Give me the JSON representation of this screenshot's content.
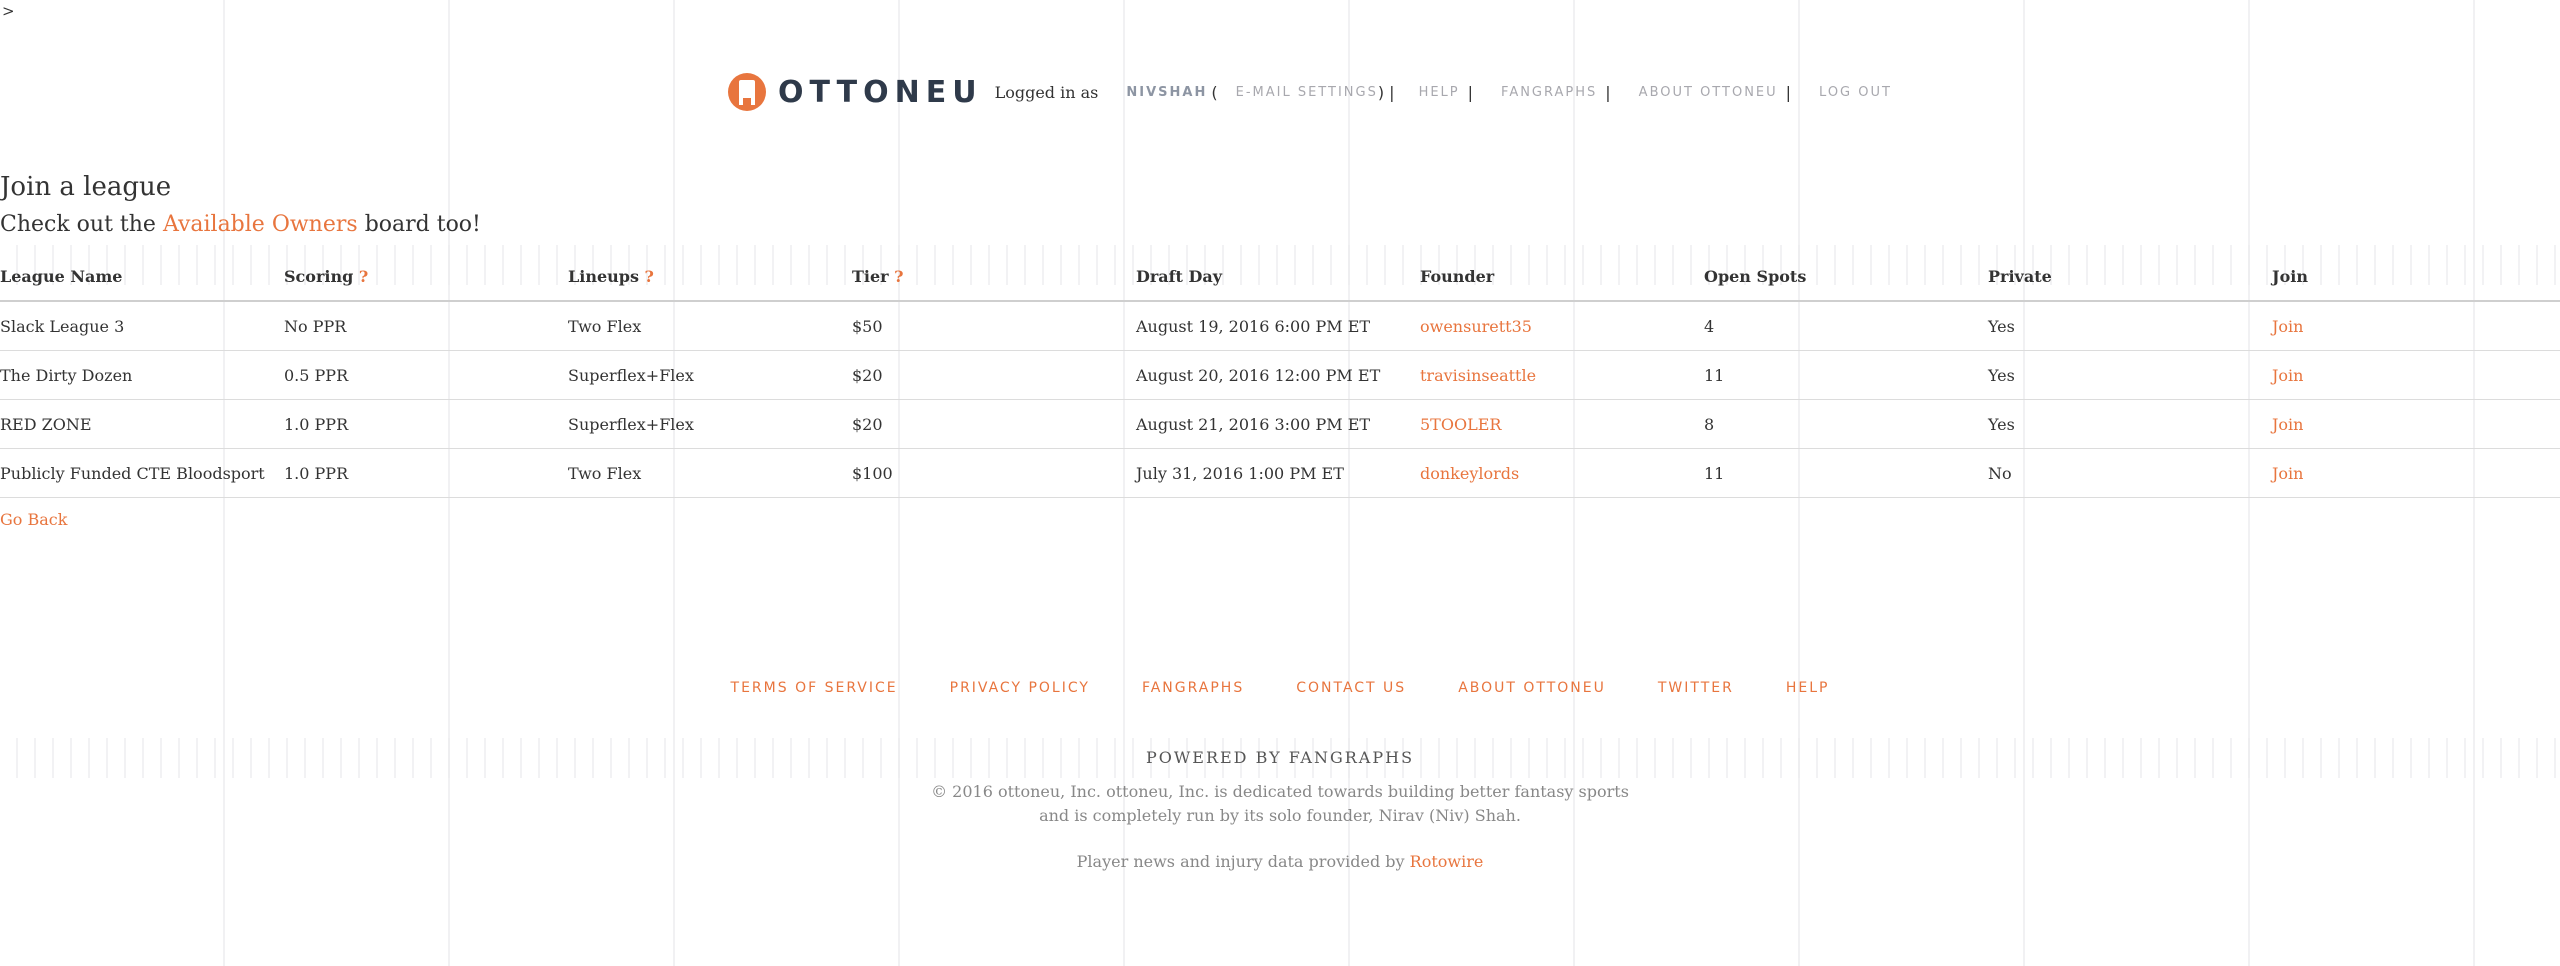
{
  "stray_char": ">",
  "header": {
    "logo_text": "OTTONEU",
    "logged_in_label": "Logged in as",
    "username": "NIVSHAH",
    "open_paren": "(",
    "email_settings": "E-MAIL SETTINGS",
    "close_paren_sep": ") |",
    "help": "HELP",
    "fangraphs": "FANGRAPHS",
    "about": "ABOUT OTTONEU",
    "logout": "LOG OUT",
    "sep": "|"
  },
  "main": {
    "title": "Join a league",
    "subtitle_before": "Check out the",
    "subtitle_link": "Available Owners",
    "subtitle_after": "board too!",
    "go_back": "Go Back"
  },
  "table": {
    "headers": {
      "league_name": "League Name",
      "scoring": "Scoring",
      "lineups": "Lineups",
      "tier": "Tier",
      "draft_day": "Draft Day",
      "founder": "Founder",
      "open_spots": "Open Spots",
      "private": "Private",
      "join": "Join",
      "help_mark": "?"
    },
    "rows": [
      {
        "league_name": "Slack League 3",
        "scoring": "No PPR",
        "lineups": "Two Flex",
        "tier": "$50",
        "draft_day": "August 19, 2016 6:00 PM ET",
        "founder": "owensurett35",
        "open_spots": "4",
        "private": "Yes",
        "join": "Join"
      },
      {
        "league_name": "The Dirty Dozen",
        "scoring": "0.5 PPR",
        "lineups": "Superflex+Flex",
        "tier": "$20",
        "draft_day": "August 20, 2016 12:00 PM ET",
        "founder": "travisinseattle",
        "open_spots": "11",
        "private": "Yes",
        "join": "Join"
      },
      {
        "league_name": "RED ZONE",
        "scoring": "1.0 PPR",
        "lineups": "Superflex+Flex",
        "tier": "$20",
        "draft_day": "August 21, 2016 3:00 PM ET",
        "founder": "5TOOLER",
        "open_spots": "8",
        "private": "Yes",
        "join": "Join"
      },
      {
        "league_name": "Publicly Funded CTE Bloodsport",
        "scoring": "1.0 PPR",
        "lineups": "Two Flex",
        "tier": "$100",
        "draft_day": "July 31, 2016 1:00 PM ET",
        "founder": "donkeylords",
        "open_spots": "11",
        "private": "No",
        "join": "Join"
      }
    ]
  },
  "footer": {
    "links": [
      "TERMS OF SERVICE",
      "PRIVACY POLICY",
      "FANGRAPHS",
      "CONTACT US",
      "ABOUT OTTONEU",
      "TWITTER",
      "HELP"
    ],
    "powered_by": "POWERED BY FANGRAPHS",
    "copyright": "© 2016 ottoneu, Inc. ottoneu, Inc. is dedicated towards building better fantasy sports and is completely run by its solo founder, Nirav (Niv) Shah.",
    "credit_before": "Player news and injury data provided by",
    "credit_link": "Rotowire"
  },
  "colors": {
    "accent": "#e8753e",
    "navy": "#2f3a4a",
    "muted": "#a8a8ae"
  }
}
